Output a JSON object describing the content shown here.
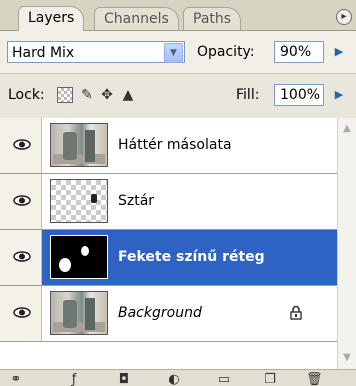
{
  "tabs": [
    {
      "label": "Layers",
      "active": true
    },
    {
      "label": "Channels",
      "active": false
    },
    {
      "label": "Paths",
      "active": false
    }
  ],
  "tab_menu_icon": "flyout-circle-icon",
  "blend_mode": {
    "selected": "Hard Mix"
  },
  "opacity": {
    "label": "Opacity:",
    "value": "90%"
  },
  "lock": {
    "label": "Lock:",
    "icons": [
      "lock-transparency-icon",
      "brush-icon",
      "move-icon",
      "lock-all-icon"
    ]
  },
  "fill": {
    "label": "Fill:",
    "value": "100%"
  },
  "layers": [
    {
      "name": "Háttér másolata",
      "thumb": "photo",
      "visible": true,
      "selected": false,
      "italic": false,
      "locked": false
    },
    {
      "name": "Sztár",
      "thumb": "checker",
      "visible": true,
      "selected": false,
      "italic": false,
      "locked": false
    },
    {
      "name": "Fekete színű réteg",
      "thumb": "black",
      "visible": true,
      "selected": true,
      "italic": false,
      "locked": false
    },
    {
      "name": "Background",
      "thumb": "photo",
      "visible": true,
      "selected": false,
      "italic": true,
      "locked": true
    }
  ],
  "bottom_icons": [
    "link-icon",
    "fx-icon",
    "mask-icon",
    "adjustment-icon",
    "group-folder-icon",
    "new-layer-icon",
    "trash-icon"
  ],
  "colors": {
    "selection": "#2e63c4",
    "panel": "#ece9d8"
  }
}
